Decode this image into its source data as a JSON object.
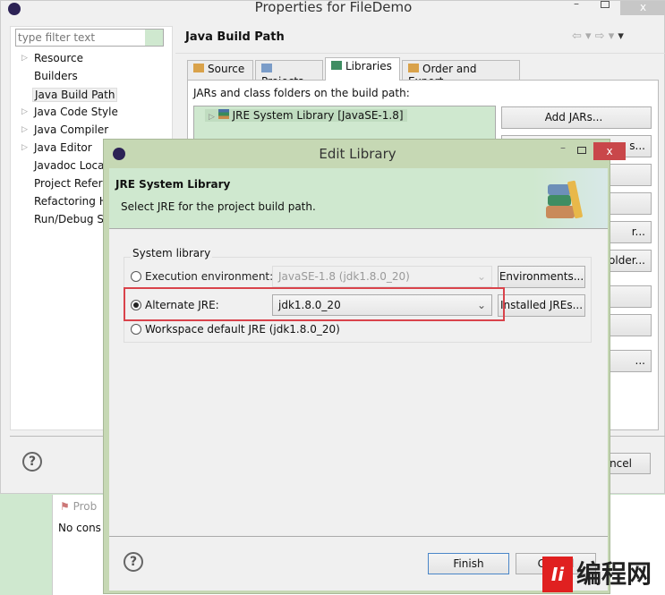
{
  "parent": {
    "title": "Properties for FileDemo",
    "filter_placeholder": "type filter text",
    "page_title": "Java Build Path",
    "tree": [
      {
        "label": "Resource",
        "expandable": true
      },
      {
        "label": "Builders",
        "expandable": false
      },
      {
        "label": "Java Build Path",
        "expandable": false,
        "selected": true
      },
      {
        "label": "Java Code Style",
        "expandable": true
      },
      {
        "label": "Java Compiler",
        "expandable": true
      },
      {
        "label": "Java Editor",
        "expandable": true
      },
      {
        "label": "Javadoc Loca",
        "expandable": false
      },
      {
        "label": "Project Refer",
        "expandable": false
      },
      {
        "label": "Refactoring H",
        "expandable": false
      },
      {
        "label": "Run/Debug S",
        "expandable": false
      }
    ],
    "tabs": [
      {
        "label": "Source",
        "icon": "source-folder-icon"
      },
      {
        "label": "Projects",
        "icon": "folder-icon"
      },
      {
        "label": "Libraries",
        "icon": "library-icon",
        "active": true
      },
      {
        "label": "Order and Export",
        "icon": "order-icon"
      }
    ],
    "jars_label": "JARs and class folders on the build path:",
    "library_entry": "JRE System Library [JavaSE-1.8]",
    "buttons": [
      "Add JARs...",
      "s...",
      "",
      "",
      "r...",
      "older...",
      "",
      "",
      "..."
    ],
    "cancel_label": "ncel"
  },
  "problems": {
    "tab_label": "Prob",
    "text": "No cons"
  },
  "dialog": {
    "title": "Edit Library",
    "header_title": "JRE System Library",
    "header_desc": "Select JRE for the project build path.",
    "group_label": "System library",
    "options": [
      {
        "label": "Execution environment:",
        "value": "JavaSE-1.8 (jdk1.8.0_20)",
        "button": "Environments...",
        "selected": false,
        "enabled": false
      },
      {
        "label": "Alternate JRE:",
        "value": "jdk1.8.0_20",
        "button": "Installed JREs...",
        "selected": true,
        "enabled": true
      },
      {
        "label": "Workspace default JRE (jdk1.8.0_20)",
        "selected": false
      }
    ],
    "finish_label": "Finish",
    "cancel_label": "Cancel",
    "highlight_color": "#d9434b"
  },
  "watermark": "编程网"
}
